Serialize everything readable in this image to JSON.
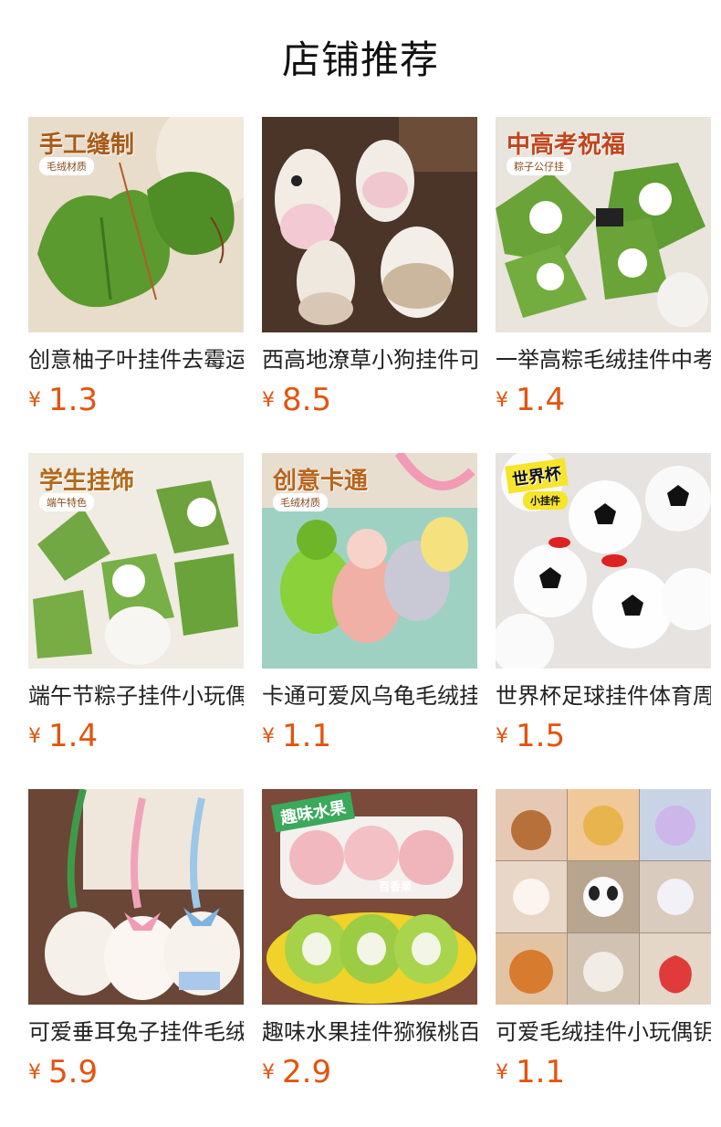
{
  "page": {
    "title": "店铺推荐",
    "currency": "¥"
  },
  "products": [
    {
      "name": "创意柚子叶挂件去霉运毛绒",
      "price": "1.3",
      "banner": "手工缝制",
      "tag": "毛绒材质",
      "image": "green-leaf-plush-keychain"
    },
    {
      "name": "西高地潦草小狗挂件可爱",
      "price": "8.5",
      "banner": "",
      "tag": "",
      "image": "fluffy-dog-plush-keychains"
    },
    {
      "name": "一举高粽毛绒挂件中考高考",
      "price": "1.4",
      "banner": "中高考祝福",
      "tag": "粽子公仔挂",
      "image": "zongzi-plush-keychains"
    },
    {
      "name": "端午节粽子挂件小玩偶毛绒",
      "price": "1.4",
      "banner": "学生挂饰",
      "tag": "端午特色",
      "image": "dragon-boat-zongzi-plush"
    },
    {
      "name": "卡通可爱风乌龟毛绒挂件",
      "price": "1.1",
      "banner": "创意卡通",
      "tag": "毛绒材质",
      "image": "turtle-plush-keychains"
    },
    {
      "name": "世界杯足球挂件体育周边",
      "price": "1.5",
      "banner": "世界杯",
      "tag": "小挂件",
      "image": "soccer-ball-plush-pile"
    },
    {
      "name": "可爱垂耳兔子挂件毛绒玩偶",
      "price": "5.9",
      "banner": "",
      "tag": "",
      "image": "lop-ear-bunny-plush"
    },
    {
      "name": "趣味水果挂件猕猴桃百香果",
      "price": "2.9",
      "banner": "趣味水果",
      "tag": "百香果",
      "image": "fruit-plush-keychains"
    },
    {
      "name": "可爱毛绒挂件小玩偶钥匙扣",
      "price": "1.1",
      "banner": "",
      "tag": "",
      "image": "assorted-animal-plush-grid"
    }
  ]
}
